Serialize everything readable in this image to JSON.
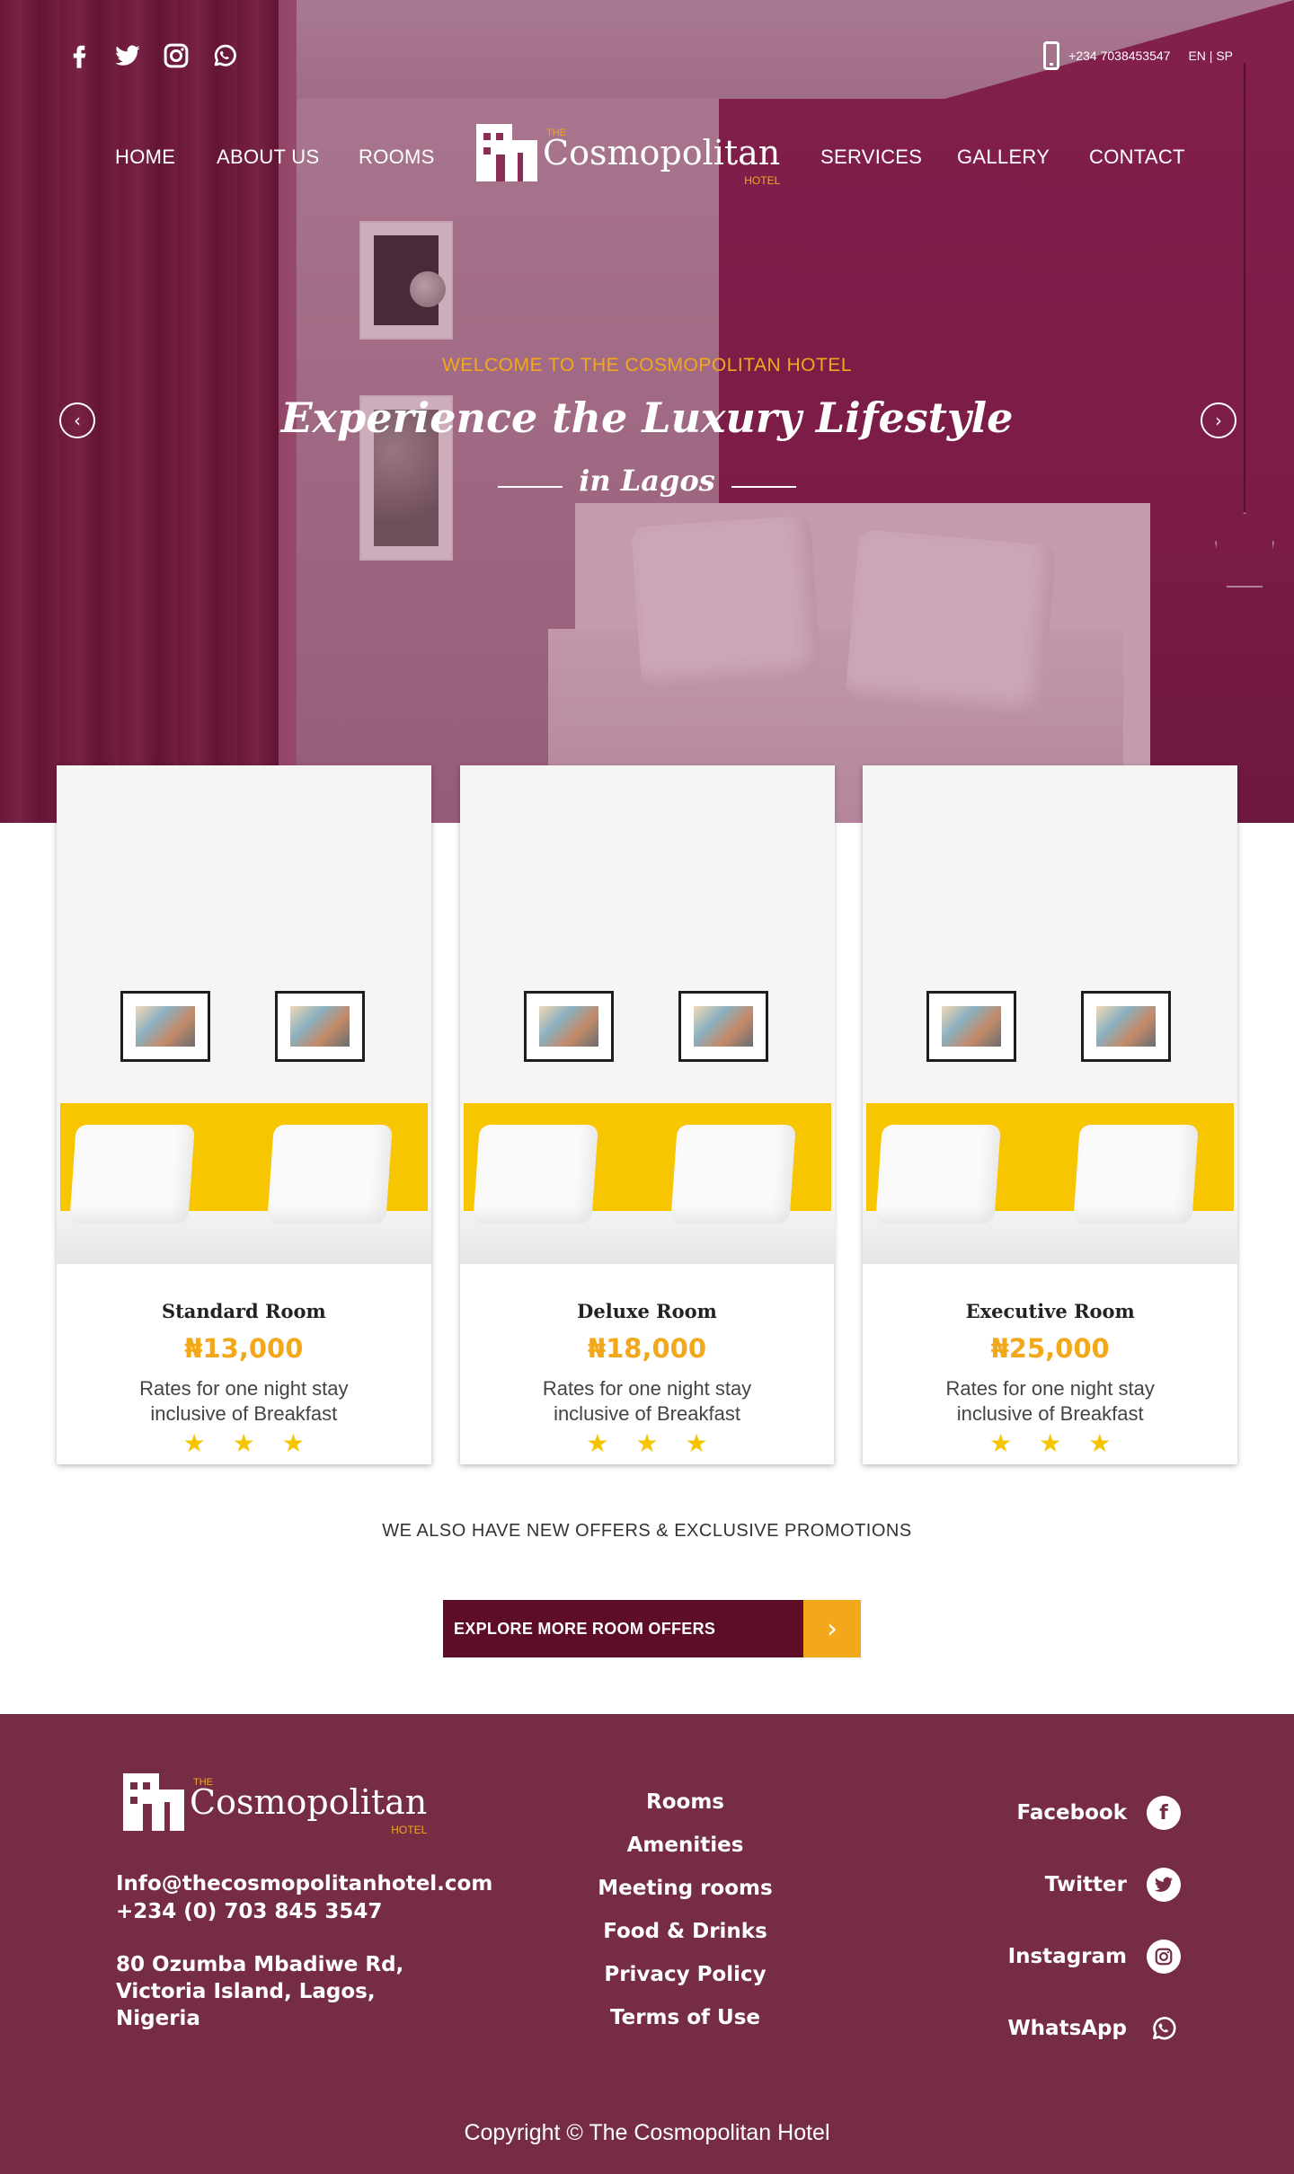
{
  "topbar": {
    "social_icons": [
      "facebook-icon",
      "twitter-icon",
      "instagram-icon",
      "whatsapp-icon"
    ],
    "phone": "+234 7038453547",
    "language": "EN | SP"
  },
  "nav": {
    "items": [
      "HOME",
      "ABOUT US",
      "ROOMS",
      "SERVICES",
      "GALLERY",
      "CONTACT"
    ]
  },
  "logo": {
    "the": "THE",
    "name": "Cosmopolitan",
    "hotel": "HOTEL"
  },
  "hero": {
    "welcome": "WELCOME TO THE COSMOPOLITAN HOTEL",
    "headline": "Experience the Luxury Lifestyle",
    "subline": "in Lagos"
  },
  "rooms": [
    {
      "title": "Standard Room",
      "price": "₦13,000",
      "desc_line1": "Rates for one night stay",
      "desc_line2": "inclusive of Breakfast",
      "stars": "★★★"
    },
    {
      "title": "Deluxe Room",
      "price": "₦18,000",
      "desc_line1": "Rates for one night stay",
      "desc_line2": "inclusive of Breakfast",
      "stars": "★★★"
    },
    {
      "title": "Executive Room",
      "price": "₦25,000",
      "desc_line1": "Rates for one night stay",
      "desc_line2": "inclusive of Breakfast",
      "stars": "★★★"
    }
  ],
  "promo": {
    "text": "WE ALSO HAVE NEW OFFERS & EXCLUSIVE PROMOTIONS",
    "cta_label": "EXPLORE MORE ROOM OFFERS"
  },
  "footer": {
    "email": "Info@thecosmopolitanhotel.com",
    "phone": "+234 (0) 703 845 3547",
    "address_line1": "80 Ozumba Mbadiwe Rd,",
    "address_line2": "Victoria Island, Lagos,",
    "address_line3": "Nigeria",
    "links": [
      "Rooms",
      "Amenities",
      "Meeting rooms",
      "Food & Drinks",
      "Privacy Policy",
      "Terms of Use"
    ],
    "social": [
      "Facebook",
      "Twitter",
      "Instagram",
      "WhatsApp"
    ],
    "copyright": "Copyright ©  The Cosmopolitan Hotel"
  },
  "colors": {
    "brand_maroon": "#5e0d26",
    "footer_bg": "#762d43",
    "accent_gold": "#f3a81c",
    "star_yellow": "#f7c400"
  }
}
